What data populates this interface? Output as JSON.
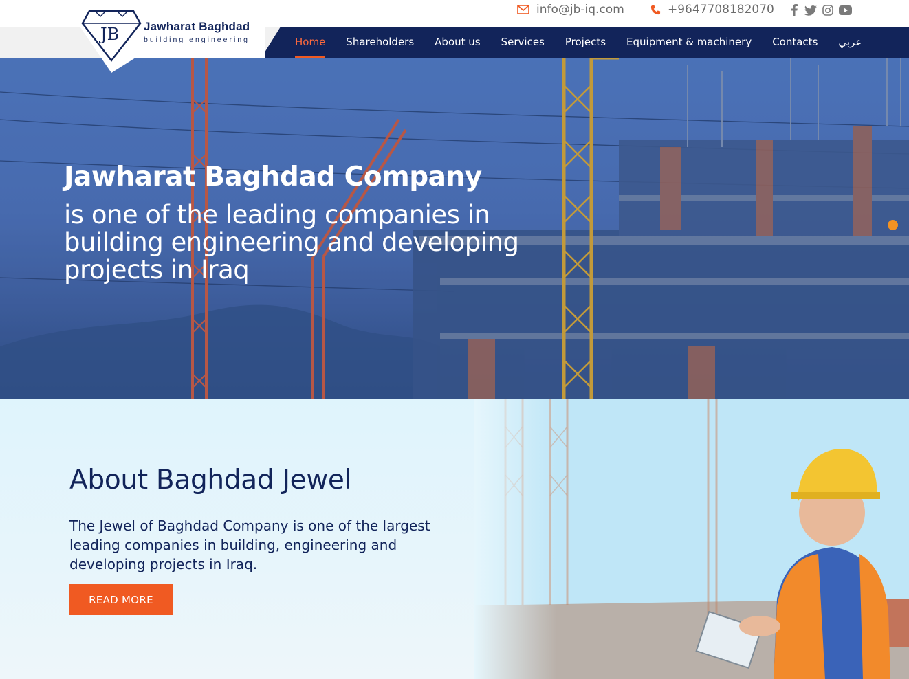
{
  "topbar": {
    "email": "info@jb-iq.com",
    "phone": "+9647708182070",
    "socials": [
      "facebook-icon",
      "twitter-icon",
      "instagram-icon",
      "youtube-icon"
    ]
  },
  "logo": {
    "monogram": "JB",
    "name": "Jawharat Baghdad",
    "tagline": "building engineering"
  },
  "nav": {
    "items": [
      {
        "label": "Home",
        "active": true
      },
      {
        "label": "Shareholders"
      },
      {
        "label": "About us"
      },
      {
        "label": "Services"
      },
      {
        "label": "Projects"
      },
      {
        "label": "Equipment & machinery"
      },
      {
        "label": "Contacts"
      },
      {
        "label": "عربي"
      }
    ]
  },
  "hero": {
    "title": "Jawharat Baghdad Company",
    "subtitle": "is one of the leading companies in building engineering and developing projects in Iraq"
  },
  "about": {
    "heading": "About Baghdad Jewel",
    "text": "The Jewel of Baghdad Company is one of the largest leading companies in building, engineering and developing projects in Iraq.",
    "button": "READ MORE"
  },
  "colors": {
    "navy": "#12245a",
    "accent": "#f05a22",
    "slider_dot": "#f39221"
  }
}
